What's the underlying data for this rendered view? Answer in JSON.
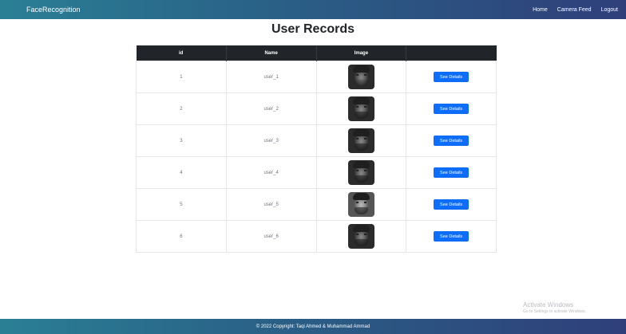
{
  "navbar": {
    "brand": "FaceRecognition",
    "links": [
      "Home",
      "Camera Feed",
      "Logout"
    ]
  },
  "page_title": "User Records",
  "table": {
    "headers": [
      "id",
      "Name",
      "Image",
      ""
    ],
    "rows": [
      {
        "id": "1",
        "name": "user_1",
        "button": "See Details"
      },
      {
        "id": "2",
        "name": "user_2",
        "button": "See Details"
      },
      {
        "id": "3",
        "name": "user_3",
        "button": "See Details"
      },
      {
        "id": "4",
        "name": "user_4",
        "button": "See Details"
      },
      {
        "id": "5",
        "name": "user_5",
        "button": "See Details"
      },
      {
        "id": "6",
        "name": "user_6",
        "button": "See Details"
      }
    ]
  },
  "watermark": {
    "line1": "Activate Windows",
    "line2": "Go to Settings to activate Windows."
  },
  "footer": {
    "text": "© 2022 Copyright: Taqi Ahmed & Muhammad Ammad"
  },
  "colors": {
    "nav_gradient_start": "#2a7f95",
    "nav_gradient_end": "#2f3f7a",
    "table_header": "#212529",
    "button": "#0d6efd"
  }
}
